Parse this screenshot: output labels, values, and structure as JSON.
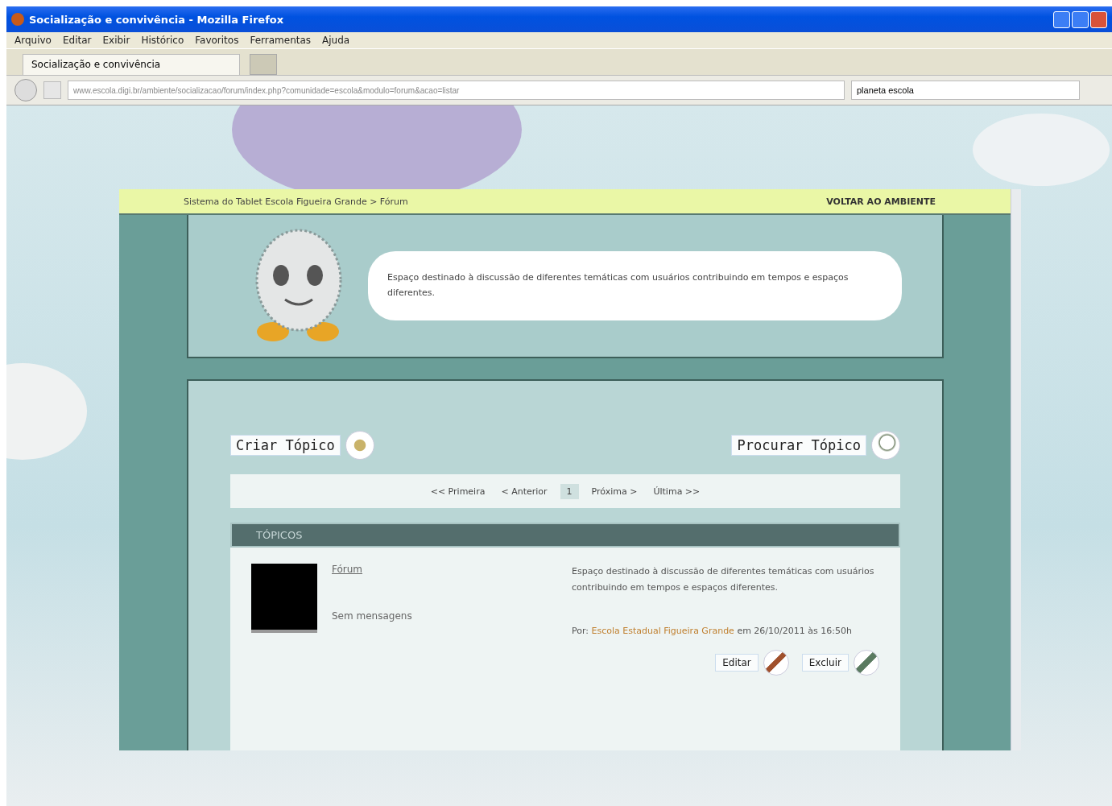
{
  "window": {
    "title": "Socialização e convivência - Mozilla Firefox"
  },
  "menu": [
    "Arquivo",
    "Editar",
    "Exibir",
    "Histórico",
    "Favoritos",
    "Ferramentas",
    "Ajuda"
  ],
  "tabs": [
    {
      "label": "Socialização e convivência",
      "selected": true
    }
  ],
  "address": {
    "value": "www.escola.digi.br/ambiente/socializacao/forum/index.php?comunidade=escola&modulo=forum&acao=listar"
  },
  "search": {
    "value": "planeta escola"
  },
  "forum": {
    "breadcrumb": "Sistema do Tablet Escola Figueira Grande > Fórum",
    "exit": "VOLTAR AO AMBIENTE",
    "intro": "Espaço destinado à discussão de diferentes temáticas com usuários contribuindo em tempos e espaços diferentes.",
    "create": "Criar Tópico",
    "find": "Procurar Tópico",
    "pager": [
      {
        "label": "<< Primeira",
        "selected": false
      },
      {
        "label": "< Anterior",
        "selected": false
      },
      {
        "label": "1",
        "selected": true
      },
      {
        "label": "Próxima >",
        "selected": false
      },
      {
        "label": "Última >>",
        "selected": false
      }
    ],
    "header": "TÓPICOS",
    "topics": [
      {
        "title": "Fórum",
        "count": "Sem mensagens",
        "description": "Espaço destinado à discussão de diferentes temáticas com usuários contribuindo em tempos e espaços diferentes.",
        "author": "Escola Estadual Figueira Grande",
        "meta_prefix": "Por:",
        "meta_suffix": "em 26/10/2011 às 16:50h",
        "edit": "Editar",
        "delete": "Excluir"
      }
    ]
  }
}
